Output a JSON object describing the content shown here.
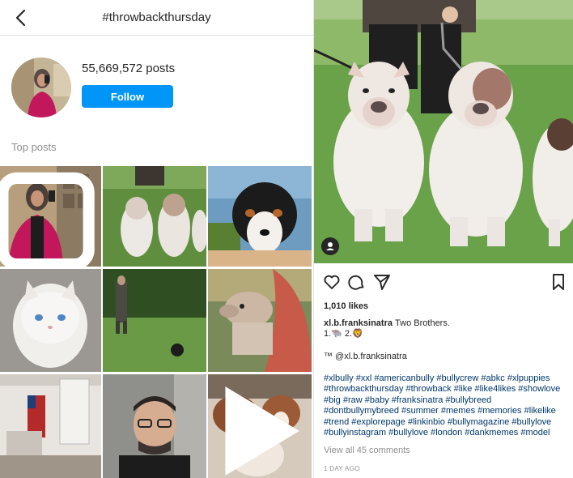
{
  "header": {
    "title": "#throwbackthursday",
    "back_icon": "chevron-left-icon"
  },
  "profile": {
    "post_count": "55,669,572 posts",
    "follow_label": "Follow"
  },
  "section": {
    "top_posts_label": "Top posts"
  },
  "grid": [
    {
      "name": "selfie-woman-hijab"
    },
    {
      "name": "two-dogs-grass"
    },
    {
      "name": "bernese-dog"
    },
    {
      "name": "white-kitten"
    },
    {
      "name": "man-with-dog-garden"
    },
    {
      "name": "dog-with-woman"
    },
    {
      "name": "living-room-flag"
    },
    {
      "name": "man-selfie-glasses"
    },
    {
      "name": "st-bernard-puppies"
    }
  ],
  "post": {
    "likes": "1,010 likes",
    "username": "xl.b.franksinatra",
    "caption": "Two Brothers.",
    "caption_line2": "1.🐃 2.🦁",
    "credit": "™ @xl.b.franksinatra",
    "hashtags": "#xlbully #xxl #americanbully #bullycrew #abkc #xlpuppies #throwbackthursday #throwback #like #like4likes #showlove #big #raw #baby #franksinatra #bullybreed #dontbullymybreed #summer #memes #memories #likelike #trend #explorepage #linkinbio #bullymagazine #bullylove #bullyinstagram #bullylove #london #dankmemes #model",
    "view_comments": "View all 45 comments",
    "time": "1 DAY AGO"
  },
  "colors": {
    "accent": "#0095f6",
    "hashtag": "#00376b",
    "muted": "#8e8e8e"
  }
}
